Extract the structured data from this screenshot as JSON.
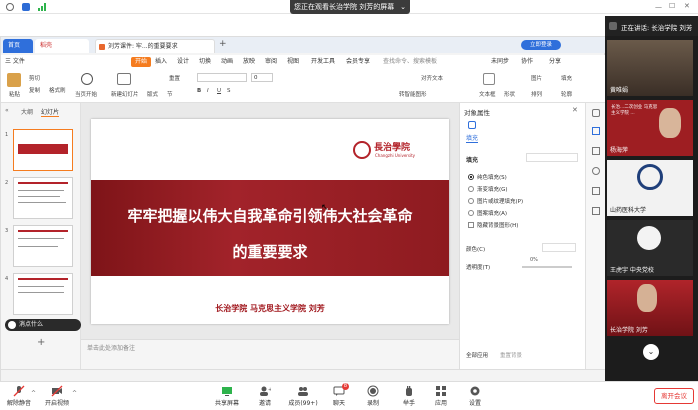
{
  "meeting": {
    "share_banner": "您正在观看长治学院  刘芳的屏幕",
    "speaking": "正在讲话: 长治学院  刘芳",
    "bottom_buttons": [
      "解除静音",
      "开启视频",
      "共享屏幕",
      "邀请",
      "成员(99+)",
      "聊天",
      "录制",
      "举手",
      "应用",
      "设置"
    ],
    "chat_badge": "8",
    "leave_button": "离开会议"
  },
  "wps": {
    "tabs": [
      "首页",
      "稻壳",
      "刘芳课件: 牢...的重要要求"
    ],
    "menu": [
      "三 文件",
      "开始",
      "插入",
      "设计",
      "切换",
      "动画",
      "放映",
      "审阅",
      "视图",
      "开发工具",
      "会员专享",
      "查找命令、搜索模板",
      "未同步",
      "协作",
      "分享"
    ],
    "ribbon": {
      "paste": "粘贴",
      "cut": "剪切",
      "copy": "复制",
      "format_painter": "格式刷",
      "from_current": "当页开始",
      "new_slide": "新建幻灯片",
      "layout": "版式",
      "section": "节",
      "reset": "重置",
      "font_size": "0",
      "text_box": "文本框",
      "shape": "形状",
      "arrange": "排列",
      "picture": "图片",
      "fill": "填充",
      "contour": "轮廓",
      "align_text": "对齐文本",
      "convert_smartart": "转智能图形"
    },
    "left_panel": {
      "tab_outline": "大纲",
      "tab_slides": "幻灯片",
      "slide_numbers": [
        "1",
        "2",
        "3",
        "4"
      ],
      "ad_text": "消点什么"
    },
    "slide": {
      "title_line1": "牢牢把握以伟大自我革命引领伟大社会革命",
      "title_line2": "的重要要求",
      "footer": "长治学院  马克思主义学院      刘芳",
      "logo_text": "長治學院",
      "logo_sub": "Changzhi University"
    },
    "notes_placeholder": "单击此处添加备注",
    "property_panel": {
      "header": "对象属性",
      "tab": "填充",
      "section": "填充",
      "options": [
        "纯色填充(S)",
        "渐变填充(G)",
        "图片或纹理填充(P)",
        "图案填充(A)",
        "隐藏背景图形(H)"
      ],
      "color_label": "颜色(C)",
      "transparency_label": "透明度(T)",
      "transparency_value": "0%",
      "apply_all": "全部应用",
      "reset_bg": "重置背景"
    }
  },
  "participants": [
    {
      "name": "黄唯娟"
    },
    {
      "name": "长治...二次创业 马克思主义学院 ..."
    },
    {
      "name": "杨海萍"
    },
    {
      "name": "山药医科大学"
    },
    {
      "name": "王虎宇 中央党校"
    },
    {
      "name": "长治学院  刘芳"
    }
  ],
  "colors": {
    "accent": "#c8161d",
    "wps_orange": "#f57c1f",
    "meeting_blue": "#1e6fd9"
  }
}
